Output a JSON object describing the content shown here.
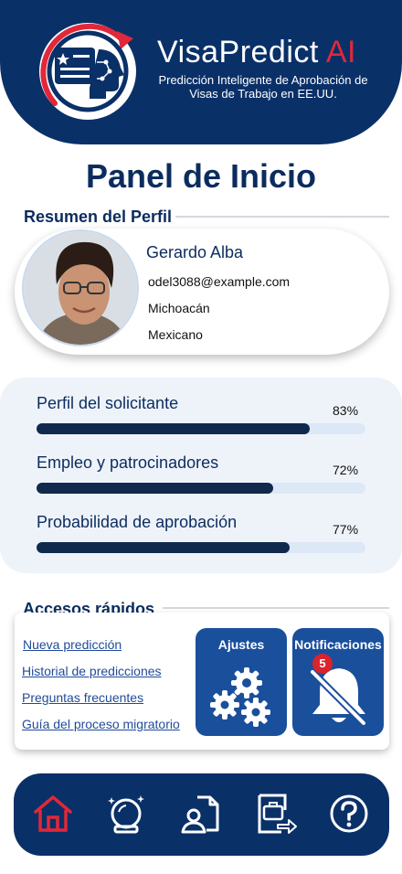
{
  "header": {
    "brand_name": "VisaPredict",
    "brand_suffix": "AI",
    "subtitle": "Predicción Inteligente de Aprobación de Visas de Trabajo en EE.UU."
  },
  "page_title": "Panel de Inicio",
  "profile": {
    "section_title": "Resumen del Perfil",
    "name": "Gerardo Alba",
    "email": "odel3088@example.com",
    "state": "Michoacán",
    "nationality": "Mexicano"
  },
  "progress": [
    {
      "label": "Perfil del solicitante",
      "percent_text": "83%",
      "value": 0.83
    },
    {
      "label": "Empleo y patrocinadores",
      "percent_text": "72%",
      "value": 0.72
    },
    {
      "label": "Probabilidad de aprobación",
      "percent_text": "77%",
      "value": 0.77
    }
  ],
  "quick_access": {
    "title": "Accesos rápidos",
    "links": [
      "Nueva predicción",
      "Historial de predicciones",
      "Preguntas frecuentes",
      "Guía del proceso migratorio"
    ],
    "settings_label": "Ajustes",
    "notifications_label": "Notificaciones",
    "notifications_count": "5"
  },
  "bottom_nav": {
    "items": [
      "home-icon",
      "crystal-ball-icon",
      "profile-document-icon",
      "briefcase-export-icon",
      "help-icon"
    ]
  },
  "colors": {
    "primary_navy": "#0a3068",
    "accent_red": "#e0283a",
    "tile_blue": "#1a4f9c",
    "progress_fill": "#0f2a4d"
  }
}
